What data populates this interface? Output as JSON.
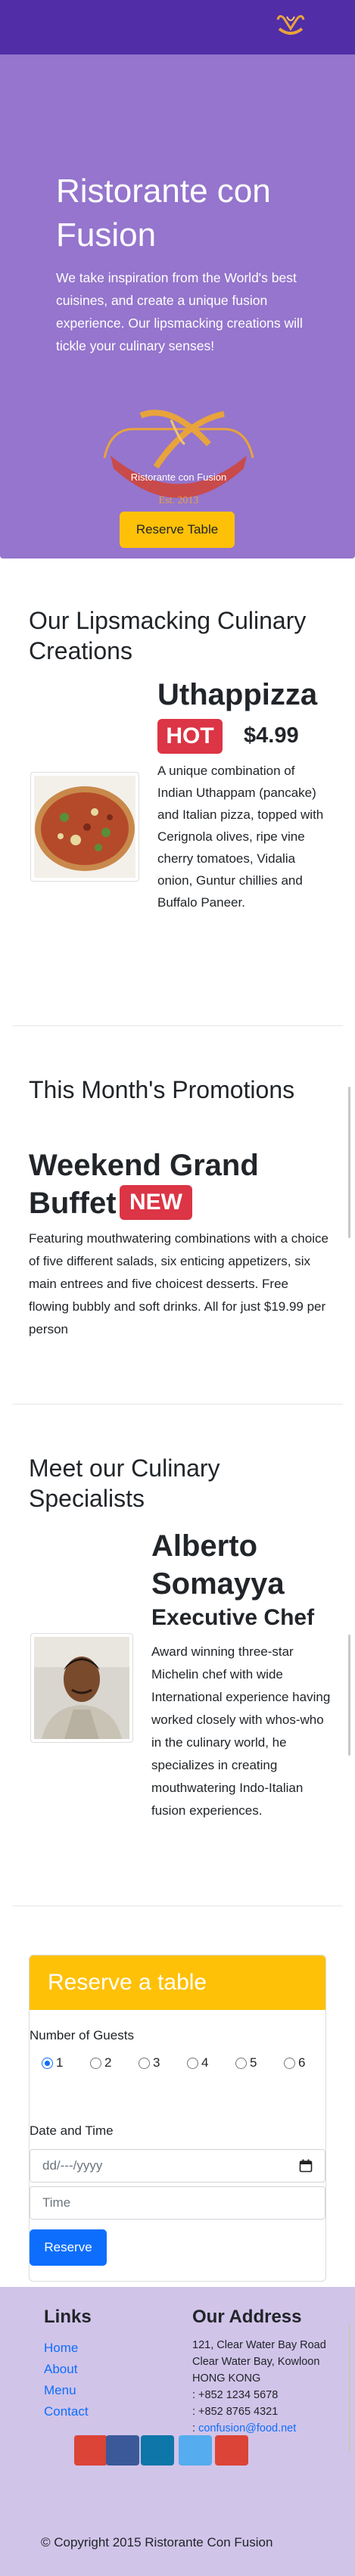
{
  "brand": {
    "name": "Ristorante con Fusion",
    "tagline": "We take inspiration from the World's best cuisines, and create a unique fusion experience. Our lipsmacking creations will tickle your culinary senses!",
    "reserve_button": "Reserve Table",
    "logo_text": "Ristorante con Fusion",
    "logo_est": "Est. 2013"
  },
  "dishes": {
    "heading": "Our Lipsmacking Culinary Creations",
    "name": "Uthappizza",
    "badge": "HOT",
    "price": "$4.99",
    "description": "A unique combination of Indian Uthappam (pancake) and Italian pizza, topped with Cerignola olives, ripe vine cherry tomatoes, Vidalia onion, Guntur chillies and Buffalo Paneer."
  },
  "promotion": {
    "heading": "This Month's Promotions",
    "name": "Weekend Grand Buffet",
    "badge": "NEW",
    "description": "Featuring mouthwatering combinations with a choice of five different salads, six enticing appetizers, six main entrees and five choicest desserts. Free flowing bubbly and soft drinks. All for just $19.99 per person"
  },
  "leader": {
    "heading": "Meet our Culinary Specialists",
    "name": "Alberto Somayya",
    "role": "Executive Chef",
    "description": "Award winning three-star Michelin chef with wide International experience having worked closely with whos-who in the culinary world, he specializes in creating mouthwatering Indo-Italian fusion experiences."
  },
  "reservation": {
    "header": "Reserve a table",
    "guests_label": "Number of Guests",
    "guest_options": [
      "1",
      "2",
      "3",
      "4",
      "5",
      "6"
    ],
    "selected_guests": "1",
    "datetime_label": "Date and Time",
    "date_placeholder": "dd/---/yyyy",
    "time_placeholder": "Time",
    "submit": "Reserve"
  },
  "footer": {
    "links_heading": "Links",
    "links": [
      "Home",
      "About",
      "Menu",
      "Contact"
    ],
    "address_heading": "Our Address",
    "address_lines": [
      "121, Clear Water Bay Road",
      "Clear Water Bay, Kowloon",
      "HONG KONG"
    ],
    "phone": ": +852 1234 5678",
    "fax": ": +852 8765 4321",
    "email_prefix": ":",
    "email": "confusion@food.net",
    "copyright": "© Copyright 2015 Ristorante Con Fusion",
    "social_colors": [
      "#DB4437",
      "#3B5998",
      "#0E76A8",
      "#55ACEE",
      "#DB4437"
    ]
  },
  "colors": {
    "navbar": "#512DA8",
    "jumbotron": "#9575CD",
    "footer": "#D1C4E9",
    "accent": "#FFC107",
    "badge": "#DC3545",
    "primary": "#0d6efd"
  }
}
